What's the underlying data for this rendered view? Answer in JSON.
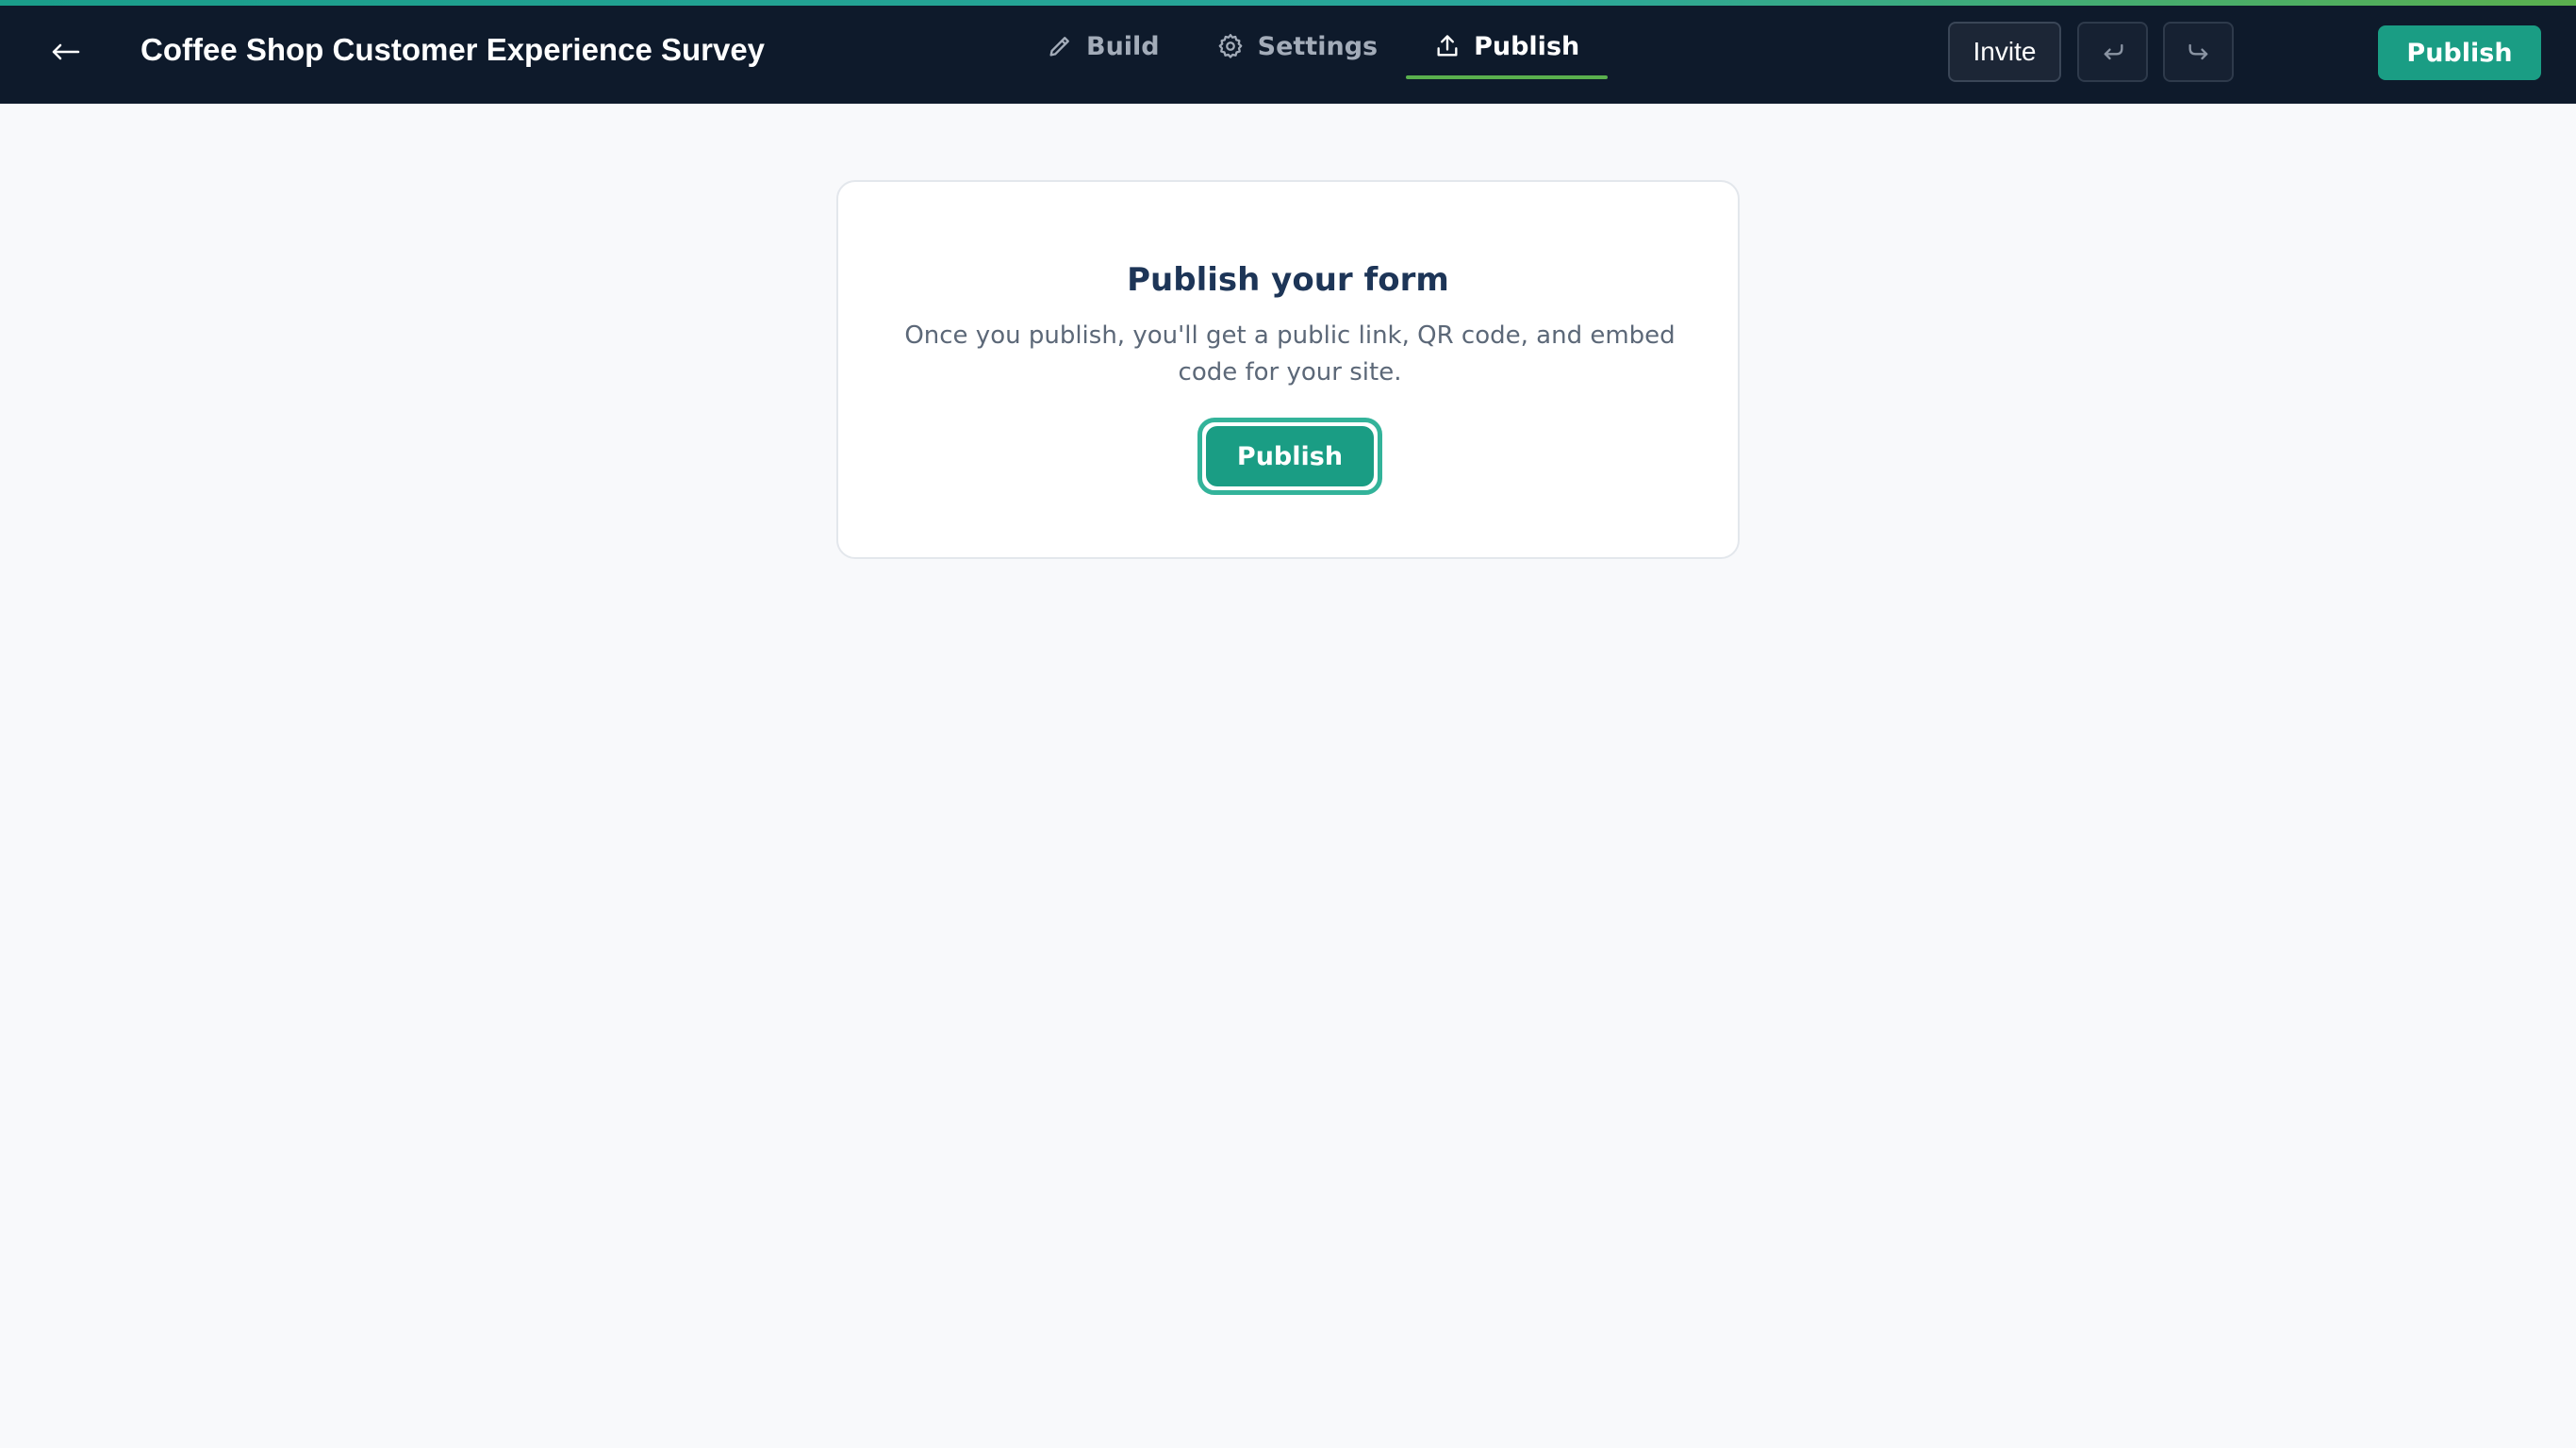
{
  "header": {
    "title": "Coffee Shop Customer Experience Survey",
    "back_icon": "arrow-left-icon",
    "tabs": [
      {
        "label": "Build",
        "icon": "pencil-icon",
        "active": false
      },
      {
        "label": "Settings",
        "icon": "gear-icon",
        "active": false
      },
      {
        "label": "Publish",
        "icon": "upload-icon",
        "active": true
      }
    ],
    "invite_label": "Invite",
    "undo_icon": "undo-icon",
    "redo_icon": "redo-icon",
    "publish_label": "Publish"
  },
  "publish_card": {
    "title": "Publish your form",
    "description": "Once you publish, you'll get a public link, QR code, and embed code for your site.",
    "button_label": "Publish"
  },
  "colors": {
    "header_bg": "#0e1a2b",
    "brand_green": "#1a9d84",
    "active_tab_underline": "#5ab04e",
    "page_bg": "#f8f9fb",
    "card_title": "#1d3557"
  }
}
